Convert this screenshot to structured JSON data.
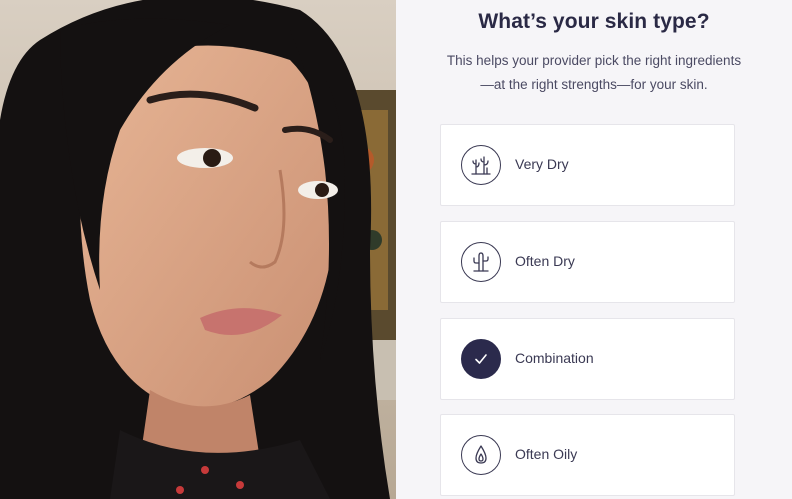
{
  "quiz": {
    "title": "What’s your skin type?",
    "subtitle_line1": "This helps your provider pick the right ingredients",
    "subtitle_line2": "—at the right strengths—for your skin.",
    "options": [
      {
        "label": "Very Dry",
        "icon": "cactus-plants-icon",
        "selected": false
      },
      {
        "label": "Often Dry",
        "icon": "cactus-icon",
        "selected": false
      },
      {
        "label": "Combination",
        "icon": "checkmark-icon",
        "selected": true
      },
      {
        "label": "Often Oily",
        "icon": "oil-drop-icon",
        "selected": false
      }
    ]
  },
  "colors": {
    "heading": "#2a2945",
    "accent_selected": "#2b2a4c",
    "panel_bg": "#f6f5f8",
    "card_border": "#e6e5ea"
  }
}
